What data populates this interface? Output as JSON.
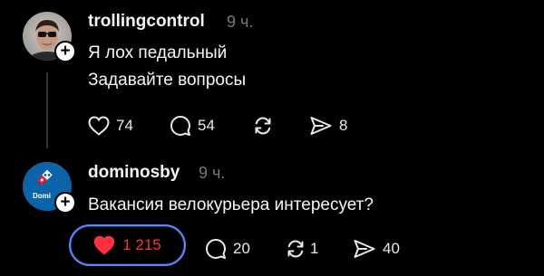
{
  "posts": [
    {
      "username": "trollingcontrol",
      "time": "9 ч.",
      "lines": [
        "Я лох педальный",
        "Задавайте вопросы"
      ],
      "actions": {
        "likes": "74",
        "comments": "54",
        "reposts": "",
        "shares": "8"
      },
      "liked": false
    },
    {
      "username": "dominosby",
      "time": "9 ч.",
      "avatar_text": "Domi",
      "lines": [
        "Вакансия велокурьера интересует?"
      ],
      "actions": {
        "likes": "1 215",
        "comments": "20",
        "reposts": "1",
        "shares": "40"
      },
      "liked": true
    }
  ],
  "colors": {
    "background": "#000000",
    "text": "#f3f5f7",
    "muted": "#777777",
    "like_active": "#ff3040",
    "focus_ring": "#5f88ff",
    "dominos_blue": "#0b63a8",
    "dominos_red": "#e31837"
  },
  "icons": {
    "like": "heart-icon",
    "comment": "comment-bubble-icon",
    "repost": "repost-icon",
    "share": "send-icon",
    "follow": "plus-icon"
  }
}
